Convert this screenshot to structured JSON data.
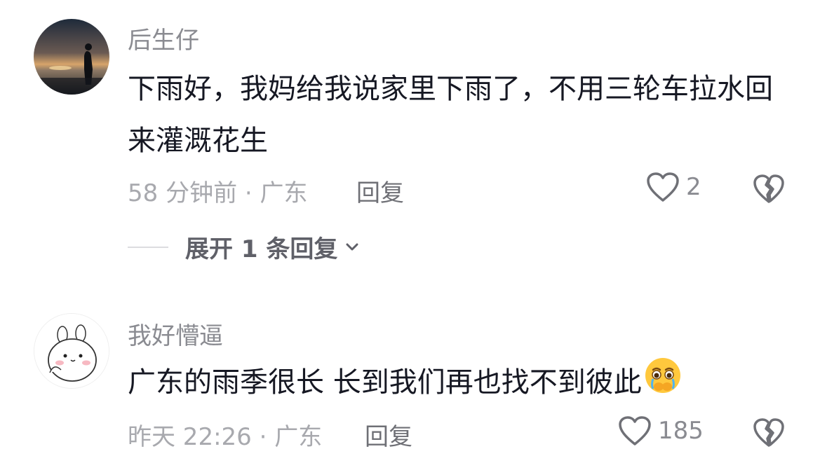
{
  "comments": [
    {
      "username": "后生仔",
      "text": "下雨好，我妈给我说家里下雨了，不用三轮车拉水回来灌溉花生",
      "meta": "58 分钟前 · 广东",
      "reply_label": "回复",
      "like_count": "2",
      "expand_label": "展开 1 条回复",
      "avatar_icon": "sunset-silhouette-avatar"
    },
    {
      "username": "我好懵逼",
      "text": "广东的雨季很长 长到我们再也找不到彼此",
      "meta": "昨天 22:26 · 广东",
      "reply_label": "回复",
      "like_count": "185",
      "emoji_icon": "teary-face-emoji",
      "avatar_icon": "cartoon-bunny-avatar"
    }
  ],
  "colors": {
    "text": "#161823",
    "username": "#8a8b91",
    "meta": "#a8a9ae",
    "reply": "#6f7076"
  }
}
